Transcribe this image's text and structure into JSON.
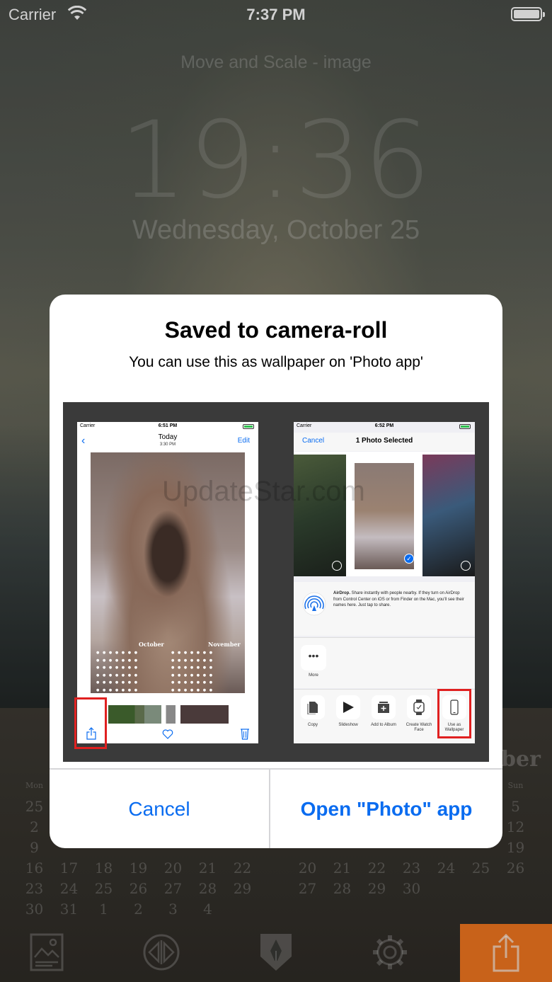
{
  "status_bar": {
    "carrier": "Carrier",
    "time": "7:37 PM"
  },
  "lock_preview": {
    "caption": "Move and Scale - image",
    "time": "19:36",
    "date": "Wednesday, October 25"
  },
  "background_calendar": {
    "month_fragment": "ber",
    "left_head": [
      "Mon",
      "",
      "",
      "",
      "",
      "",
      ""
    ],
    "left_rows": [
      [
        "25",
        "",
        "",
        "",
        "",
        "",
        ""
      ],
      [
        "2",
        "",
        "",
        "",
        "",
        "",
        ""
      ],
      [
        "9",
        "",
        "",
        "",
        "",
        "",
        ""
      ],
      [
        "16",
        "17",
        "18",
        "19",
        "20",
        "21",
        "22"
      ],
      [
        "23",
        "24",
        "25",
        "26",
        "27",
        "28",
        "29"
      ],
      [
        "30",
        "31",
        "1",
        "2",
        "3",
        "4",
        ""
      ]
    ],
    "right_head": [
      "",
      "",
      "",
      "",
      "",
      "",
      "Sun"
    ],
    "right_rows": [
      [
        "",
        "",
        "",
        "",
        "",
        "",
        "5"
      ],
      [
        "",
        "",
        "",
        "",
        "",
        "",
        "12"
      ],
      [
        "",
        "",
        "",
        "",
        "",
        "",
        "19"
      ],
      [
        "20",
        "21",
        "22",
        "23",
        "24",
        "25",
        "26"
      ],
      [
        "27",
        "28",
        "29",
        "30",
        "",
        "",
        ""
      ],
      [
        "",
        "",
        "",
        "",
        "",
        "",
        ""
      ]
    ]
  },
  "toolbar": {
    "icons": [
      "image-icon",
      "flip-icon",
      "pen-icon",
      "gear-icon",
      "share-icon"
    ],
    "accent": "#f47820"
  },
  "alert": {
    "title": "Saved to camera-roll",
    "message": "You can use this as wallpaper on 'Photo app'",
    "cancel_label": "Cancel",
    "open_label": "Open \"Photo\" app",
    "button_color": "#0a6cf0"
  },
  "instruction_image": {
    "watermark": "UpdateStar.com",
    "left_phone": {
      "carrier": "Carrier",
      "time": "6:51 PM",
      "title": "Today",
      "subtitle": "3:30 PM",
      "edit": "Edit",
      "month1": "October",
      "month2": "November"
    },
    "right_phone": {
      "carrier": "Carrier",
      "time": "6:52 PM",
      "cancel": "Cancel",
      "title": "1 Photo Selected",
      "airdrop_title": "AirDrop.",
      "airdrop_text": "Share instantly with people nearby. If they turn on AirDrop from Control Center on iOS or from Finder on the Mac, you'll see their names here. Just tap to share.",
      "more": "More",
      "actions": [
        "Copy",
        "Slideshow",
        "Add to Album",
        "Create Watch Face",
        "Use as Wallpaper"
      ]
    }
  }
}
